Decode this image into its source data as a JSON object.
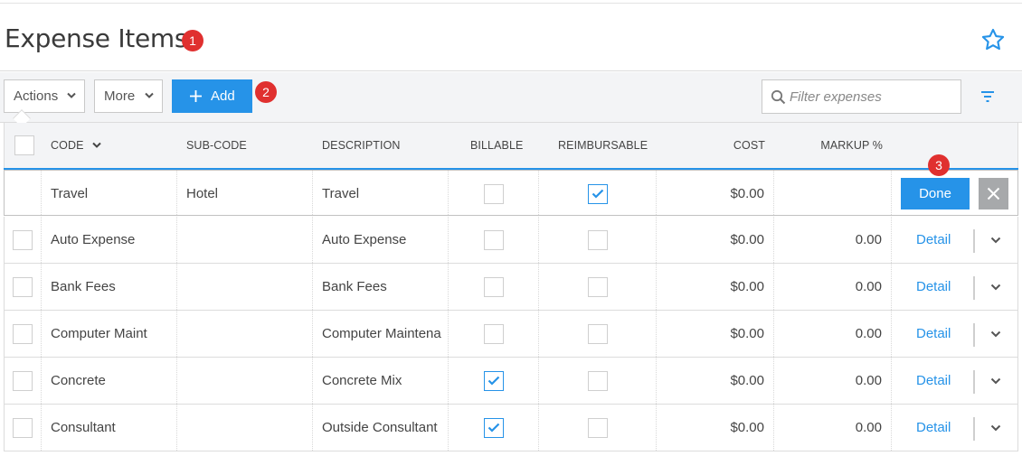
{
  "page": {
    "title": "Expense Items",
    "favorite_icon": "star-outline-icon"
  },
  "annotations": [
    "1",
    "2",
    "3"
  ],
  "toolbar": {
    "actions_label": "Actions",
    "more_label": "More",
    "add_label": "Add",
    "filter_placeholder": "Filter expenses",
    "filter_icon": "funnel-lines-icon"
  },
  "columns": {
    "code": "CODE",
    "subcode": "SUB-CODE",
    "description": "DESCRIPTION",
    "billable": "BILLABLE",
    "reimbursable": "REIMBURSABLE",
    "cost": "COST",
    "markup": "MARKUP %"
  },
  "edit_row": {
    "code": "Travel",
    "subcode": "Hotel",
    "description": "Travel",
    "billable": false,
    "reimbursable": true,
    "cost": "$0.00",
    "done_label": "Done"
  },
  "rows": [
    {
      "code": "Auto Expense",
      "subcode": "",
      "description": "Auto Expense",
      "billable": false,
      "reimbursable": false,
      "cost": "$0.00",
      "markup": "0.00",
      "action": "Detail"
    },
    {
      "code": "Bank Fees",
      "subcode": "",
      "description": "Bank Fees",
      "billable": false,
      "reimbursable": false,
      "cost": "$0.00",
      "markup": "0.00",
      "action": "Detail"
    },
    {
      "code": "Computer Maint",
      "subcode": "",
      "description": "Computer Maintena",
      "billable": false,
      "reimbursable": false,
      "cost": "$0.00",
      "markup": "0.00",
      "action": "Detail"
    },
    {
      "code": "Concrete",
      "subcode": "",
      "description": "Concrete Mix",
      "billable": true,
      "reimbursable": false,
      "cost": "$0.00",
      "markup": "0.00",
      "action": "Detail"
    },
    {
      "code": "Consultant",
      "subcode": "",
      "description": "Outside Consultant",
      "billable": true,
      "reimbursable": false,
      "cost": "$0.00",
      "markup": "0.00",
      "action": "Detail"
    }
  ],
  "colors": {
    "accent": "#2693e8",
    "badge": "#e0302f",
    "cancel_button": "#a7a9ab"
  }
}
